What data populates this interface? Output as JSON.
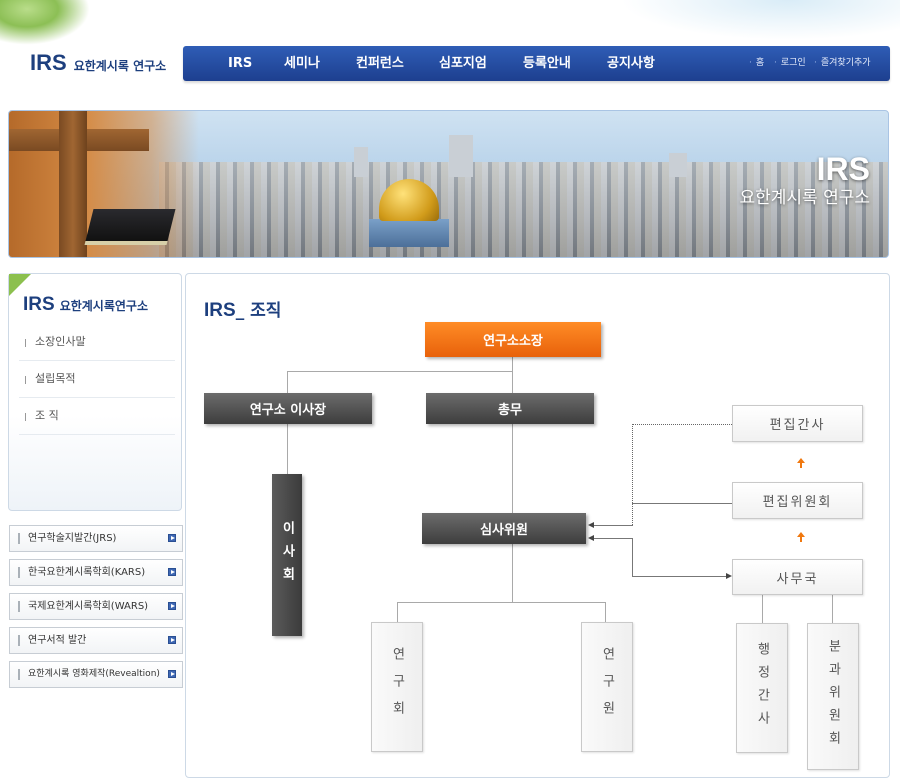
{
  "header": {
    "logo_irs": "IRS",
    "logo_ko": "요한계시록 연구소",
    "nav": [
      "IRS",
      "세미나",
      "컨퍼런스",
      "심포지엄",
      "등록안내",
      "공지사항"
    ],
    "util": [
      "홈",
      "로그인",
      "즐겨찾기추가"
    ]
  },
  "banner": {
    "title": "IRS",
    "subtitle": "요한계시록 연구소"
  },
  "sidebar": {
    "title_irs": "IRS",
    "title_ko": "요한계시록연구소",
    "items": [
      "소장인사말",
      "설립목적",
      "조 직"
    ],
    "links": [
      "연구학술지발간(JRS)",
      "한국요한계시록학회(KARS)",
      "국제요한계시록학회(WARS)",
      "연구서적 발간",
      "요한계시록 영화제작(Revealtion)"
    ]
  },
  "content": {
    "title_irs": "IRS",
    "title_rest": "_ 조직",
    "org": {
      "director": "연구소소장",
      "chairman": "연구소 이사장",
      "general_affairs": "총무",
      "board": "이사회",
      "review_committee": "심사위원",
      "editor": "편집간사",
      "editorial_committee": "편집위원회",
      "secretariat": "사무국",
      "research_society": "연구회",
      "researcher": "연구원",
      "admin_secretary": "행정간사",
      "subcommittee": "분과위원회"
    }
  },
  "colors": {
    "nav_blue": "#2f5db6",
    "brand_navy": "#1d3f7e",
    "accent_orange": "#f0780f",
    "accent_green": "#8cc04e"
  }
}
